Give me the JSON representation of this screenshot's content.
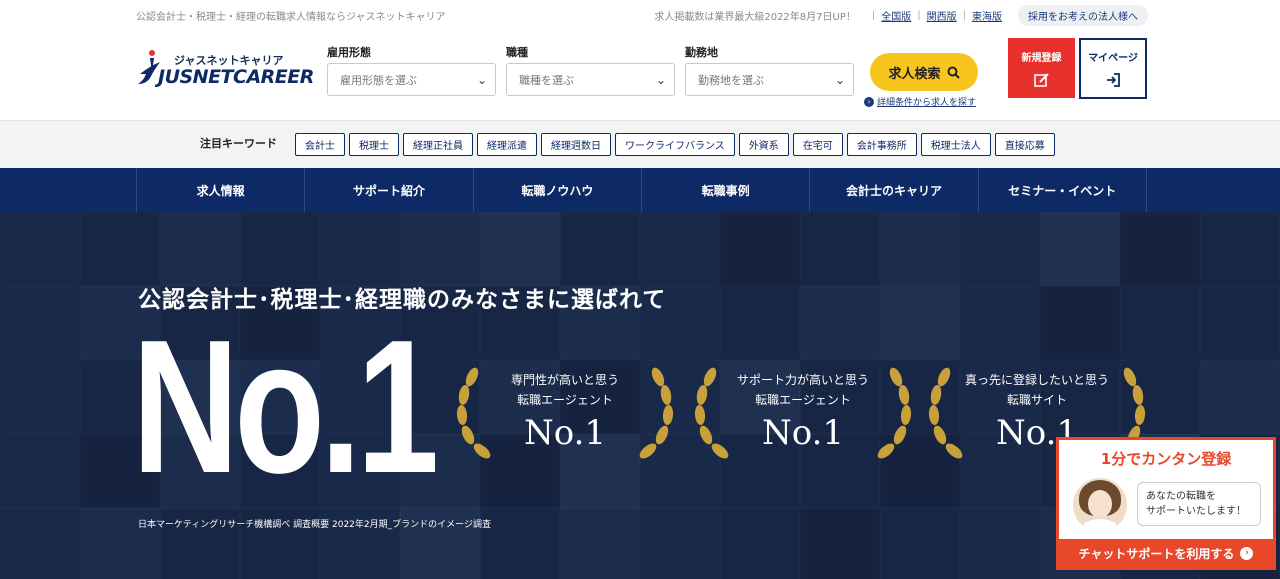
{
  "top": {
    "tagline": "公認会計士・税理士・経理の転職求人情報ならジャスネットキャリア",
    "notice": "求人掲載数は業界最大級2022年8月7日UP！",
    "regions": [
      "全国版",
      "関西版",
      "東海版"
    ],
    "corporate": "採用をお考えの法人様へ"
  },
  "logo": {
    "kana": "ジャスネットキャリア",
    "en": "JUSNETCAREER"
  },
  "search": {
    "employment_label": "雇用形態",
    "employment_placeholder": "雇用形態を選ぶ",
    "job_label": "職種",
    "job_placeholder": "職種を選ぶ",
    "location_label": "勤務地",
    "location_placeholder": "勤務地を選ぶ",
    "button": "求人検索",
    "detail_link": "詳細条件から求人を探す"
  },
  "header_buttons": {
    "register": "新規登録",
    "mypage": "マイページ"
  },
  "keywords": {
    "title": "注目キーワード",
    "items": [
      "会計士",
      "税理士",
      "経理正社員",
      "経理派遣",
      "経理週数日",
      "ワークライフバランス",
      "外資系",
      "在宅可",
      "会計事務所",
      "税理士法人",
      "直接応募"
    ]
  },
  "nav": [
    "求人情報",
    "サポート紹介",
    "転職ノウハウ",
    "転職事例",
    "会計士のキャリア",
    "セミナー・イベント"
  ],
  "hero": {
    "headline": "公認会計士･税理士･経理職のみなさまに選ばれて",
    "big": "No.1",
    "note": "日本マーケティングリサーチ機構調べ 調査概要 2022年2月期_ブランドのイメージ調査",
    "awards": [
      {
        "line1": "専門性が高いと思う",
        "line2": "転職エージェント",
        "rank": "No.1"
      },
      {
        "line1": "サポート力が高いと思う",
        "line2": "転職エージェント",
        "rank": "No.1"
      },
      {
        "line1": "真っ先に登録したいと思う",
        "line2": "転職サイト",
        "rank": "No.1"
      }
    ]
  },
  "chat": {
    "title": "1分でカンタン登録",
    "bubble_line1": "あなたの転職を",
    "bubble_line2": "サポートいたします！",
    "cta": "チャットサポートを利用する"
  },
  "colors": {
    "navy": "#0d2a66",
    "yellow": "#f7c51e",
    "red": "#e8312d",
    "orange": "#e8482a",
    "gold": "#c9a13a"
  }
}
